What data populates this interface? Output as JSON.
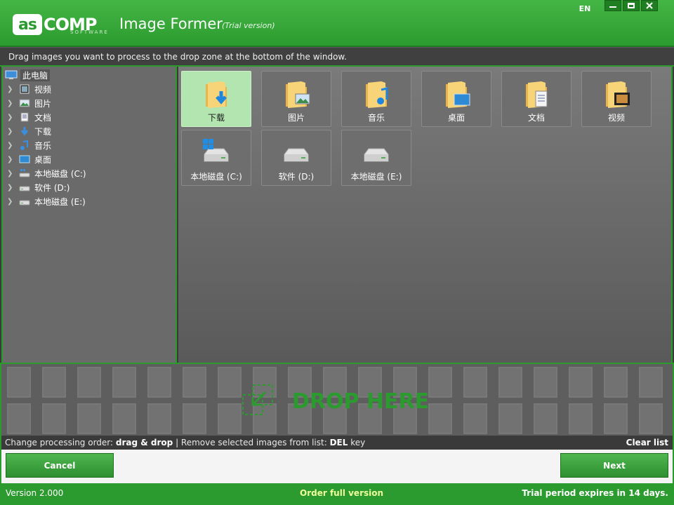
{
  "title_bar": {
    "logo_box_text": "as",
    "logo_text": "COMP",
    "logo_subtitle": "SOFTWARE",
    "app_name": "Image Former",
    "app_edition": "(Trial version)",
    "language": "EN",
    "accent_color": "#2c9b2f"
  },
  "instructions": "Drag images you want to process to the drop zone at the bottom of the window.",
  "tree": {
    "root": "此电脑",
    "items": [
      {
        "label": "视频",
        "icon": "video-icon"
      },
      {
        "label": "图片",
        "icon": "pictures-icon"
      },
      {
        "label": "文档",
        "icon": "documents-icon"
      },
      {
        "label": "下载",
        "icon": "download-icon"
      },
      {
        "label": "音乐",
        "icon": "music-icon"
      },
      {
        "label": "桌面",
        "icon": "desktop-icon"
      },
      {
        "label": "本地磁盘 (C:)",
        "icon": "drive-c-icon"
      },
      {
        "label": "软件 (D:)",
        "icon": "drive-icon"
      },
      {
        "label": "本地磁盘 (E:)",
        "icon": "drive-icon"
      }
    ]
  },
  "folders": [
    {
      "label": "下载",
      "icon": "download-folder-icon",
      "selected": true
    },
    {
      "label": "图片",
      "icon": "pictures-folder-icon",
      "selected": false
    },
    {
      "label": "音乐",
      "icon": "music-folder-icon",
      "selected": false
    },
    {
      "label": "桌面",
      "icon": "desktop-folder-icon",
      "selected": false
    },
    {
      "label": "文档",
      "icon": "documents-folder-icon",
      "selected": false
    },
    {
      "label": "视频",
      "icon": "video-folder-icon",
      "selected": false
    },
    {
      "label": "本地磁盘 (C:)",
      "icon": "drive-c-icon",
      "selected": false
    },
    {
      "label": "软件 (D:)",
      "icon": "drive-icon",
      "selected": false
    },
    {
      "label": "本地磁盘 (E:)",
      "icon": "drive-icon",
      "selected": false
    }
  ],
  "drop_zone": {
    "text": "DROP HERE"
  },
  "hint": {
    "part1": "Change processing order: ",
    "part2": "drag & drop",
    "part3": " | Remove selected images from list: ",
    "part4": "DEL",
    "part5": " key",
    "clear_label": "Clear list"
  },
  "buttons": {
    "cancel": "Cancel",
    "next": "Next"
  },
  "status": {
    "version": "Version 2.000",
    "order": "Order full version",
    "trial": "Trial period expires in 14 days."
  }
}
